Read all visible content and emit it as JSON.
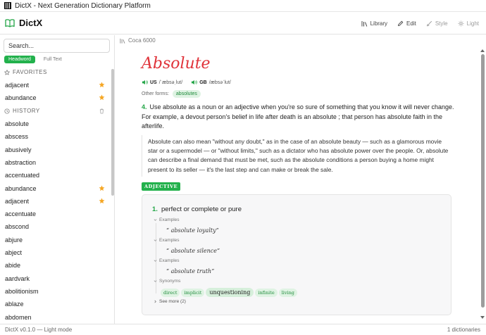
{
  "window": {
    "title": "DictX - Next Generation Dictionary Platform"
  },
  "header": {
    "brand": "DictX",
    "nav": [
      {
        "label": "Library",
        "icon": "library-icon"
      },
      {
        "label": "Edit",
        "icon": "pencil-icon"
      },
      {
        "label": "Style",
        "icon": "brush-icon"
      },
      {
        "label": "Light",
        "icon": "sun-icon"
      }
    ]
  },
  "sidebar": {
    "search_placeholder": "Search...",
    "modes": [
      "Headword",
      "Full Text"
    ],
    "active_mode": "Headword",
    "favorites_title": "FAVORITES",
    "favorites": [
      {
        "word": "adjacent",
        "starred": true
      },
      {
        "word": "abundance",
        "starred": true
      }
    ],
    "history_title": "HISTORY",
    "history": [
      {
        "word": "absolute",
        "starred": false
      },
      {
        "word": "abscess",
        "starred": false
      },
      {
        "word": "abusively",
        "starred": false
      },
      {
        "word": "abstraction",
        "starred": false
      },
      {
        "word": "accentuated",
        "starred": false
      },
      {
        "word": "abundance",
        "starred": true
      },
      {
        "word": "adjacent",
        "starred": true
      },
      {
        "word": "accentuate",
        "starred": false
      },
      {
        "word": "abscond",
        "starred": false
      },
      {
        "word": "abjure",
        "starred": false
      },
      {
        "word": "abject",
        "starred": false
      },
      {
        "word": "abide",
        "starred": false
      },
      {
        "word": "aardvark",
        "starred": false
      },
      {
        "word": "abolitionism",
        "starred": false
      },
      {
        "word": "ablaze",
        "starred": false
      },
      {
        "word": "abdomen",
        "starred": false
      }
    ]
  },
  "entry": {
    "dictionary": "Coca 6000",
    "headword": "Absolute",
    "pronunciations": [
      {
        "region": "US",
        "ipa": "/ˈæbsəˌlut/"
      },
      {
        "region": "GB",
        "ipa": "/æbsəˈlut/"
      }
    ],
    "other_forms_label": "Other forms:",
    "other_forms": [
      "absolutes"
    ],
    "sense_number": "4.",
    "sense_text": "Use absolute as a noun or an adjective when you're so sure of something that you know it will never change. For example, a devout person's belief in life after death is an absolute ; that person has absolute faith in the afterlife.",
    "note": "Absolute can also mean \"without any doubt,\" as in the case of an absolute beauty — such as a glamorous movie star or a supermodel — or \"without limits,\" such as a dictator who has absolute power over the people. Or, absolute can describe a final demand that must be met, such as the absolute conditions a person buying a home might present to its seller — it's the last step and can make or break the sale.",
    "pos": "ADJECTIVE",
    "definition_number": "1.",
    "definition": "perfect or complete or pure",
    "examples_label": "Examples",
    "examples": [
      "“ absolute loyalty”",
      "“ absolute silence”",
      "“ absolute truth”"
    ],
    "synonyms_label": "Synonyms",
    "synonyms": [
      "direct",
      "implicit",
      "unquestioning",
      "infinite",
      "living"
    ],
    "see_more": "See more (2)"
  },
  "status": {
    "left": "DictX v0.1.0 — Light mode",
    "right": "1 dictionaries"
  },
  "colors": {
    "accent": "#22b14c",
    "headword": "#e0333a",
    "star": "#f5a623"
  }
}
